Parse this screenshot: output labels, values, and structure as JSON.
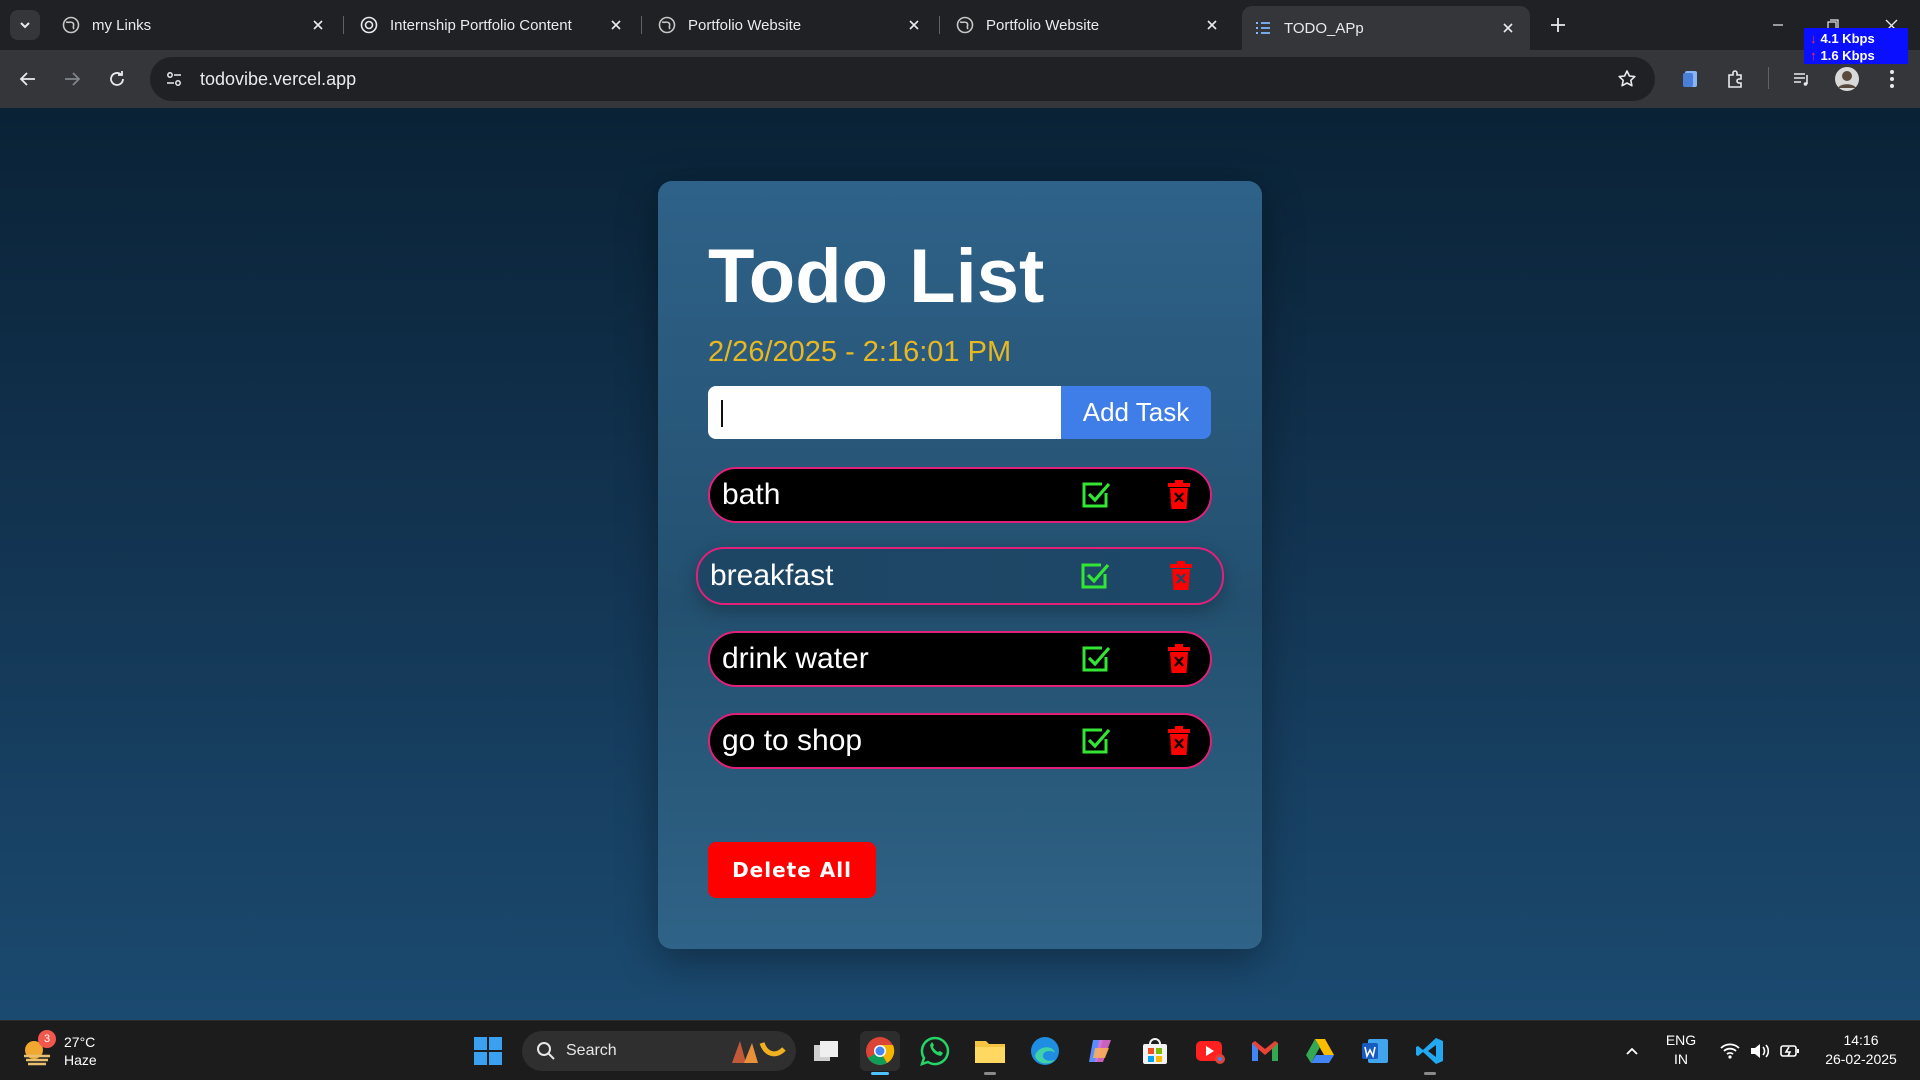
{
  "browser": {
    "tabs": [
      {
        "title": "my Links",
        "icon": "globe-icon"
      },
      {
        "title": "Internship Portfolio Content",
        "icon": "openai-icon"
      },
      {
        "title": "Portfolio Website",
        "icon": "globe-icon"
      },
      {
        "title": "Portfolio Website",
        "icon": "globe-icon"
      },
      {
        "title": "TODO_APp",
        "icon": "list-icon",
        "active": true
      }
    ],
    "url": "todovibe.vercel.app",
    "net_down": "4.1 Kbps",
    "net_up": "1.6 Kbps"
  },
  "app": {
    "title": "Todo List",
    "datetime": "2/26/2025 - 2:16:01 PM",
    "input_value": "",
    "add_button": "Add Task",
    "delete_all_button": "Delete All",
    "todos": [
      {
        "text": "bath"
      },
      {
        "text": "breakfast"
      },
      {
        "text": "drink water"
      },
      {
        "text": "go to shop"
      }
    ],
    "colors": {
      "accent_title": "#ffffff",
      "datetime": "#e8b820",
      "add_button": "#3f7ee8",
      "todo_border": "#e0217a",
      "check": "#33e633",
      "delete": "#ff0000"
    }
  },
  "taskbar": {
    "weather_temp": "27°C",
    "weather_desc": "Haze",
    "weather_badge": "3",
    "search_label": "Search",
    "lang_top": "ENG",
    "lang_bottom": "IN",
    "time": "14:16",
    "date": "26-02-2025"
  }
}
